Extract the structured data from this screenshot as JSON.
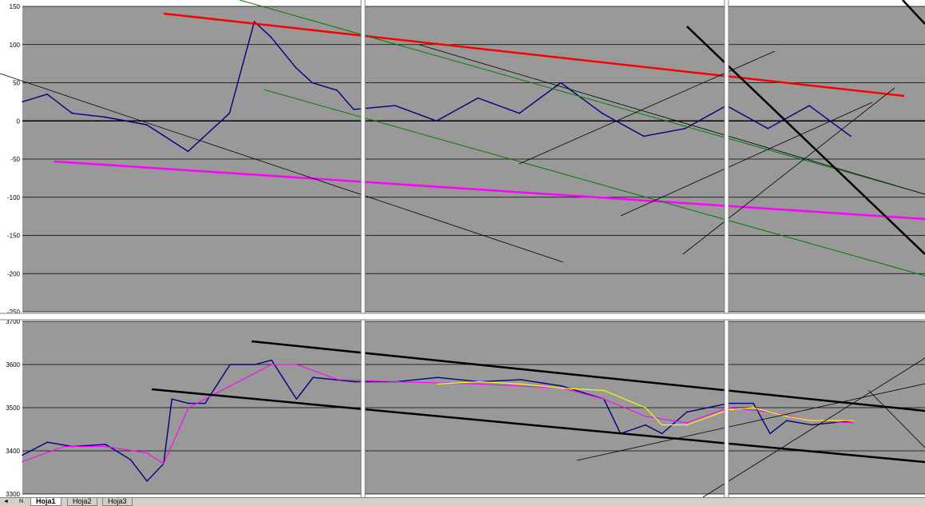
{
  "colors": {
    "plot_bg": "#999999",
    "series_blue": "#000080",
    "red_line": "#ff0000",
    "magenta_line": "#ff00ff",
    "green_line": "#008000",
    "yellow_line": "#ffff00",
    "black_line": "#000000",
    "grid": "#000000"
  },
  "tabs": {
    "nav_label": "N",
    "items": [
      "Hoja1",
      "Hoja2",
      "Hoja3"
    ],
    "active": "Hoja1"
  },
  "chart_data": [
    {
      "type": "line",
      "title": "",
      "xlabel": "",
      "ylabel": "",
      "ylim": [
        -250,
        150
      ],
      "yticks": [
        150,
        100,
        50,
        0,
        -50,
        -100,
        -150,
        -200,
        -250
      ],
      "grid": true,
      "series": [
        {
          "color": "#000080",
          "x": [
            0,
            3,
            6,
            10,
            15,
            20,
            25,
            28,
            30,
            33,
            35,
            38,
            40,
            45,
            50,
            55,
            60,
            65,
            70,
            75,
            80,
            85,
            90,
            95,
            100
          ],
          "values": [
            25,
            35,
            10,
            5,
            -5,
            -40,
            10,
            130,
            110,
            70,
            50,
            40,
            15,
            20,
            0,
            30,
            10,
            50,
            10,
            -20,
            -10,
            20,
            -10,
            20,
            -20
          ]
        }
      ]
    },
    {
      "type": "line",
      "title": "",
      "xlabel": "",
      "ylabel": "",
      "ylim": [
        3300,
        3700
      ],
      "yticks": [
        3700,
        3600,
        3500,
        3400,
        3300
      ],
      "grid": true,
      "series": [
        {
          "color": "#000080",
          "x": [
            0,
            3,
            6,
            10,
            13,
            15,
            17,
            18,
            20,
            22,
            25,
            28,
            30,
            33,
            35,
            40,
            45,
            50,
            55,
            60,
            65,
            70,
            72,
            75,
            77,
            80,
            85,
            88,
            90,
            92,
            95,
            100
          ],
          "values": [
            3390,
            3420,
            3410,
            3415,
            3380,
            3330,
            3370,
            3520,
            3510,
            3510,
            3600,
            3600,
            3610,
            3520,
            3570,
            3560,
            3560,
            3570,
            3560,
            3565,
            3550,
            3520,
            3440,
            3460,
            3440,
            3490,
            3510,
            3510,
            3440,
            3470,
            3460,
            3470
          ]
        },
        {
          "color": "#ff00ff",
          "x": [
            0,
            5,
            10,
            15,
            17,
            20,
            25,
            30,
            33,
            38,
            45,
            55,
            65,
            70,
            75,
            80,
            85,
            90,
            95,
            100
          ],
          "values": [
            3375,
            3410,
            3410,
            3395,
            3370,
            3500,
            3550,
            3600,
            3600,
            3565,
            3560,
            3555,
            3545,
            3520,
            3480,
            3465,
            3500,
            3490,
            3470,
            3465
          ]
        },
        {
          "color": "#ffff00",
          "x": [
            50,
            55,
            60,
            65,
            70,
            75,
            77,
            80,
            85,
            88,
            92,
            95,
            100
          ],
          "values": [
            3555,
            3560,
            3555,
            3545,
            3540,
            3500,
            3460,
            3460,
            3495,
            3500,
            3480,
            3470,
            3470
          ]
        }
      ]
    }
  ]
}
